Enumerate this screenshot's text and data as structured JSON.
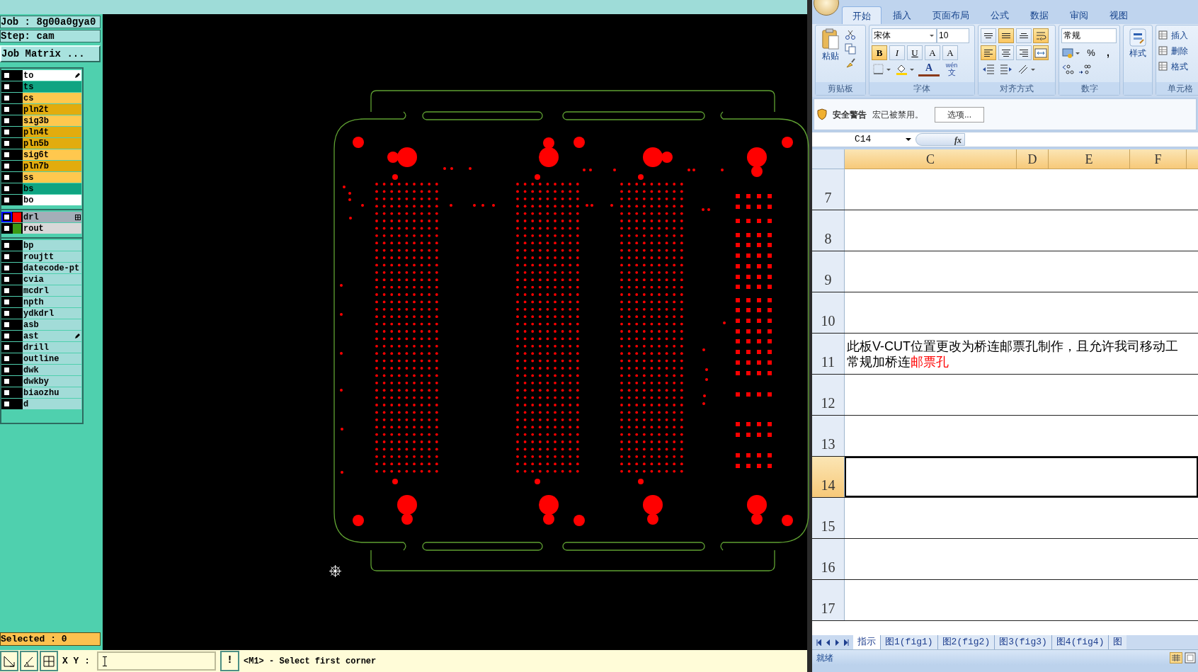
{
  "cam": {
    "job": "Job : 8g00a0gya0",
    "step": "Step: cam",
    "matrix_button": "Job Matrix ...",
    "layer_groups": [
      [
        {
          "name": "to",
          "color": "#ffffff",
          "active": false,
          "kind": "pen"
        },
        {
          "name": "ts",
          "color": "#10a482",
          "active": false
        },
        {
          "name": "cs",
          "color": "#ffc84e",
          "active": false
        },
        {
          "name": "pln2t",
          "color": "#e2ac0e",
          "active": false
        },
        {
          "name": "sig3b",
          "color": "#ffc84e",
          "active": false
        },
        {
          "name": "pln4t",
          "color": "#e2ac0e",
          "active": false
        },
        {
          "name": "pln5b",
          "color": "#e2ac0e",
          "active": false
        },
        {
          "name": "sig6t",
          "color": "#ffc84e",
          "active": false
        },
        {
          "name": "pln7b",
          "color": "#e2ac0e",
          "active": false
        },
        {
          "name": "ss",
          "color": "#ffc84e",
          "active": false
        },
        {
          "name": "bs",
          "color": "#10a482",
          "active": false
        },
        {
          "name": "bo",
          "color": "#ffffff",
          "active": false
        }
      ],
      [
        {
          "name": "drl",
          "color": "#a4aeb8",
          "active": true,
          "swatch": {
            "color": "#ff0000"
          },
          "kind": "grid"
        },
        {
          "name": "rout",
          "color": "#d8d8d8",
          "active": false,
          "swatch": {
            "color": "#3c9a14"
          }
        }
      ],
      [
        {
          "name": "bp",
          "color": "#a2dcd8",
          "active": false
        },
        {
          "name": "roujtt",
          "color": "#a2dcd8",
          "active": false
        },
        {
          "name": "datecode-pt",
          "color": "#a2dcd8",
          "active": false
        },
        {
          "name": "cvia",
          "color": "#a2dcd8",
          "active": false
        },
        {
          "name": "mcdrl",
          "color": "#a2dcd8",
          "active": false
        },
        {
          "name": "npth",
          "color": "#a2dcd8",
          "active": false
        },
        {
          "name": "ydkdrl",
          "color": "#a2dcd8",
          "active": false
        },
        {
          "name": "asb",
          "color": "#a2dcd8",
          "active": false
        },
        {
          "name": "ast",
          "color": "#a2dcd8",
          "active": false,
          "kind": "pen"
        },
        {
          "name": "drill",
          "color": "#a2dcd8",
          "active": false
        },
        {
          "name": "outline",
          "color": "#a2dcd8",
          "active": false
        },
        {
          "name": "dwk",
          "color": "#a2dcd8",
          "active": false
        },
        {
          "name": "dwkby",
          "color": "#a2dcd8",
          "active": false
        },
        {
          "name": "biaozhu",
          "color": "#a2dcd8",
          "active": false
        },
        {
          "name": "d",
          "color": "#a2dcd8",
          "active": false
        }
      ]
    ],
    "selected": "Selected : 0",
    "coord_label": "X Y :",
    "exclaim": "!",
    "message": "<M1> - Select first corner"
  },
  "excel": {
    "tabs": [
      {
        "label": "开始",
        "selected": true
      },
      {
        "label": "插入",
        "selected": false
      },
      {
        "label": "页面布局",
        "selected": false
      },
      {
        "label": "公式",
        "selected": false
      },
      {
        "label": "数据",
        "selected": false
      },
      {
        "label": "审阅",
        "selected": false
      },
      {
        "label": "视图",
        "selected": false
      }
    ],
    "clipboard": {
      "label": "剪贴板",
      "paste": "粘贴"
    },
    "font": {
      "label": "字体",
      "name": "宋体",
      "size": "10",
      "buttons": [
        {
          "kind": "bold",
          "label": "B",
          "selected": true
        },
        {
          "kind": "italic",
          "label": "I",
          "selected": false
        },
        {
          "kind": "underline",
          "label": "U",
          "selected": false
        },
        {
          "kind": "grow",
          "label": "A",
          "selected": false
        },
        {
          "kind": "shrink",
          "label": "A",
          "selected": false
        }
      ],
      "phonetic": "文",
      "phonetic_sup": "wén",
      "color_letter": "A"
    },
    "alignment": {
      "label": "对齐方式",
      "buttons": [
        {
          "kind": "align-top",
          "selected": false
        },
        {
          "kind": "align-middle",
          "selected": true
        },
        {
          "kind": "align-bottom",
          "selected": false
        },
        {
          "kind": "wrap",
          "selected": true
        },
        {
          "kind": "align-left",
          "selected": true
        },
        {
          "kind": "align-center",
          "selected": false
        },
        {
          "kind": "align-right",
          "selected": false
        },
        {
          "kind": "merge",
          "selected": true
        }
      ]
    },
    "number": {
      "label": "数字",
      "format": "常规",
      "percent": "%",
      "comma": ","
    },
    "styles": {
      "label": "样式"
    },
    "cells": {
      "label": "单元格",
      "items": [
        "插入",
        "删除",
        "格式"
      ]
    },
    "security": {
      "title": "安全警告",
      "message": "宏已被禁用。",
      "button": "选项..."
    },
    "name_box": "C14",
    "fx": "fx",
    "columns": [
      {
        "label": "C"
      },
      {
        "label": "D"
      },
      {
        "label": "E"
      },
      {
        "label": "F"
      }
    ],
    "rows": [
      {
        "number": "7",
        "selected": false
      },
      {
        "number": "8",
        "selected": false
      },
      {
        "number": "9",
        "selected": false
      },
      {
        "number": "10",
        "selected": false
      },
      {
        "number": "11",
        "selected": false,
        "lines": [
          [
            {
              "text": "此板V-CUT位置更改为桥连邮票孔制作，且允许我司移动工"
            }
          ],
          [
            {
              "text": "常规加桥连"
            },
            {
              "text": "邮票孔",
              "color": "#ff0000"
            }
          ]
        ]
      },
      {
        "number": "12",
        "selected": false
      },
      {
        "number": "13",
        "selected": false
      },
      {
        "number": "14",
        "selected": true
      },
      {
        "number": "15",
        "selected": false
      },
      {
        "number": "16",
        "selected": false
      },
      {
        "number": "17",
        "selected": false
      }
    ],
    "sheet_tabs": [
      {
        "label": "指示",
        "selected": true
      },
      {
        "label": "图1(fig1)",
        "selected": false
      },
      {
        "label": "图2(fig2)",
        "selected": false
      },
      {
        "label": "图3(fig3)",
        "selected": false
      },
      {
        "label": "图4(fig4)",
        "selected": false
      },
      {
        "label": "图",
        "selected": false
      }
    ],
    "status": "就绪"
  }
}
